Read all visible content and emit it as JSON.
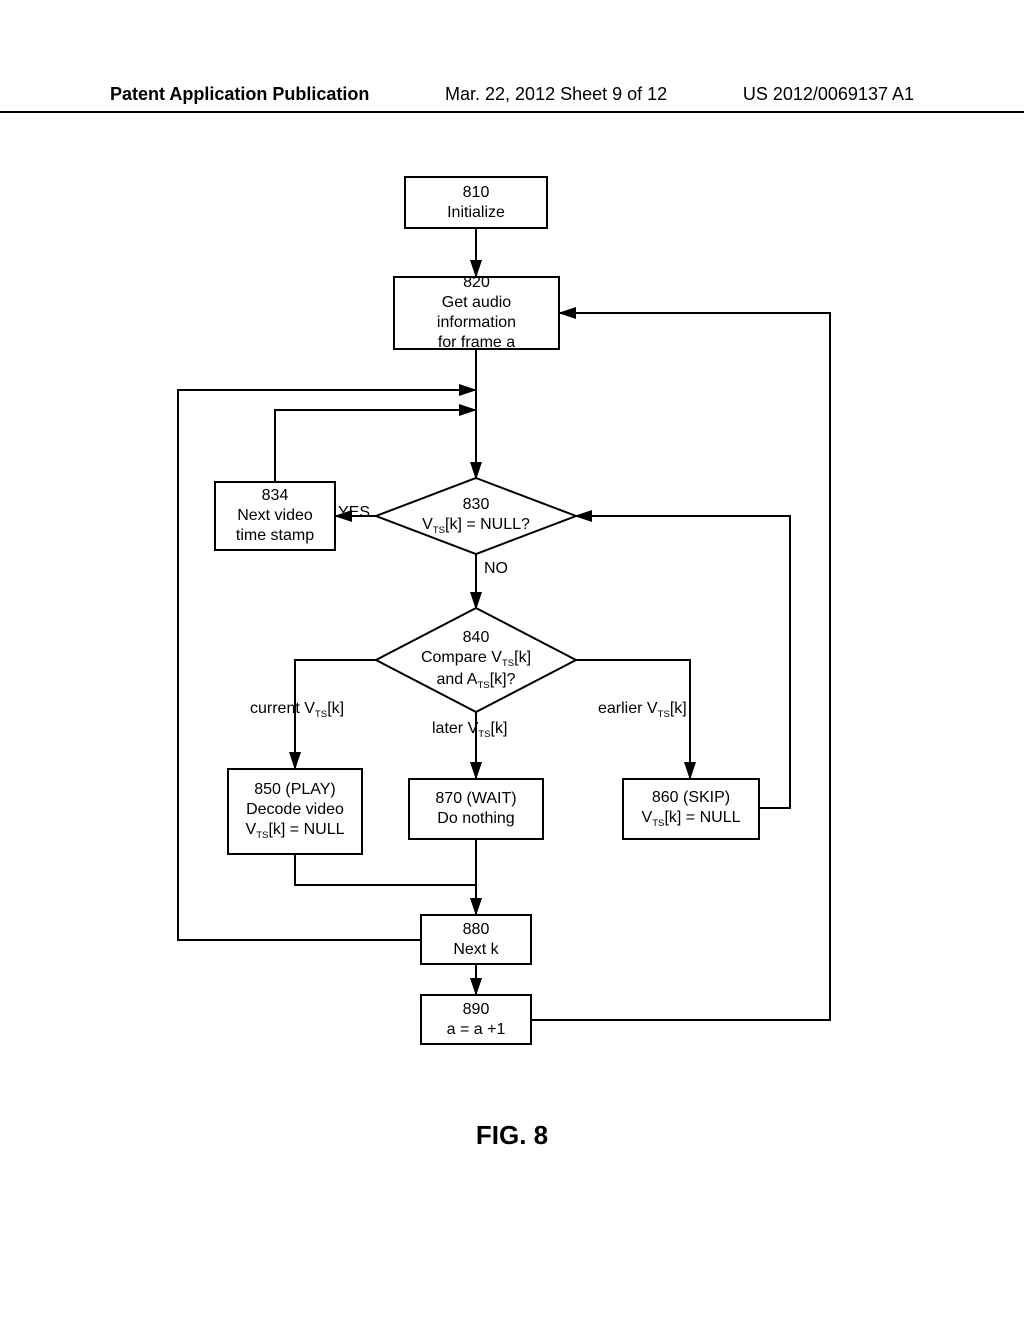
{
  "header": {
    "left": "Patent Application Publication",
    "mid": "Mar. 22, 2012  Sheet 9 of 12",
    "right": "US 2012/0069137 A1"
  },
  "nodes": {
    "n810": {
      "num": "810",
      "text": "Initialize"
    },
    "n820": {
      "num": "820",
      "text1": "Get audio information",
      "text2": "for frame a"
    },
    "n830": {
      "num": "830",
      "text_html": "V<sub>TS</sub>[k] = NULL?"
    },
    "n834": {
      "num": "834",
      "text1": "Next video",
      "text2": "time stamp"
    },
    "n840": {
      "num": "840",
      "text1_html": "Compare V<sub>TS</sub>[k]",
      "text2_html": "and A<sub>TS</sub>[k]?"
    },
    "n850": {
      "num": "850 (PLAY)",
      "text1": "Decode video",
      "text2_html": "V<sub>TS</sub>[k] = NULL"
    },
    "n860": {
      "num": "860 (SKIP)",
      "text1_html": "V<sub>TS</sub>[k] = NULL"
    },
    "n870": {
      "num": "870 (WAIT)",
      "text": "Do nothing"
    },
    "n880": {
      "num": "880",
      "text": "Next k"
    },
    "n890": {
      "num": "890",
      "text": "a = a +1"
    }
  },
  "labels": {
    "yes": "YES",
    "no": "NO",
    "current": "current V<sub>TS</sub>[k]",
    "later": "later V<sub>TS</sub>[k]",
    "earlier": "earlier V<sub>TS</sub>[k]"
  },
  "figure_caption": "FIG. 8"
}
